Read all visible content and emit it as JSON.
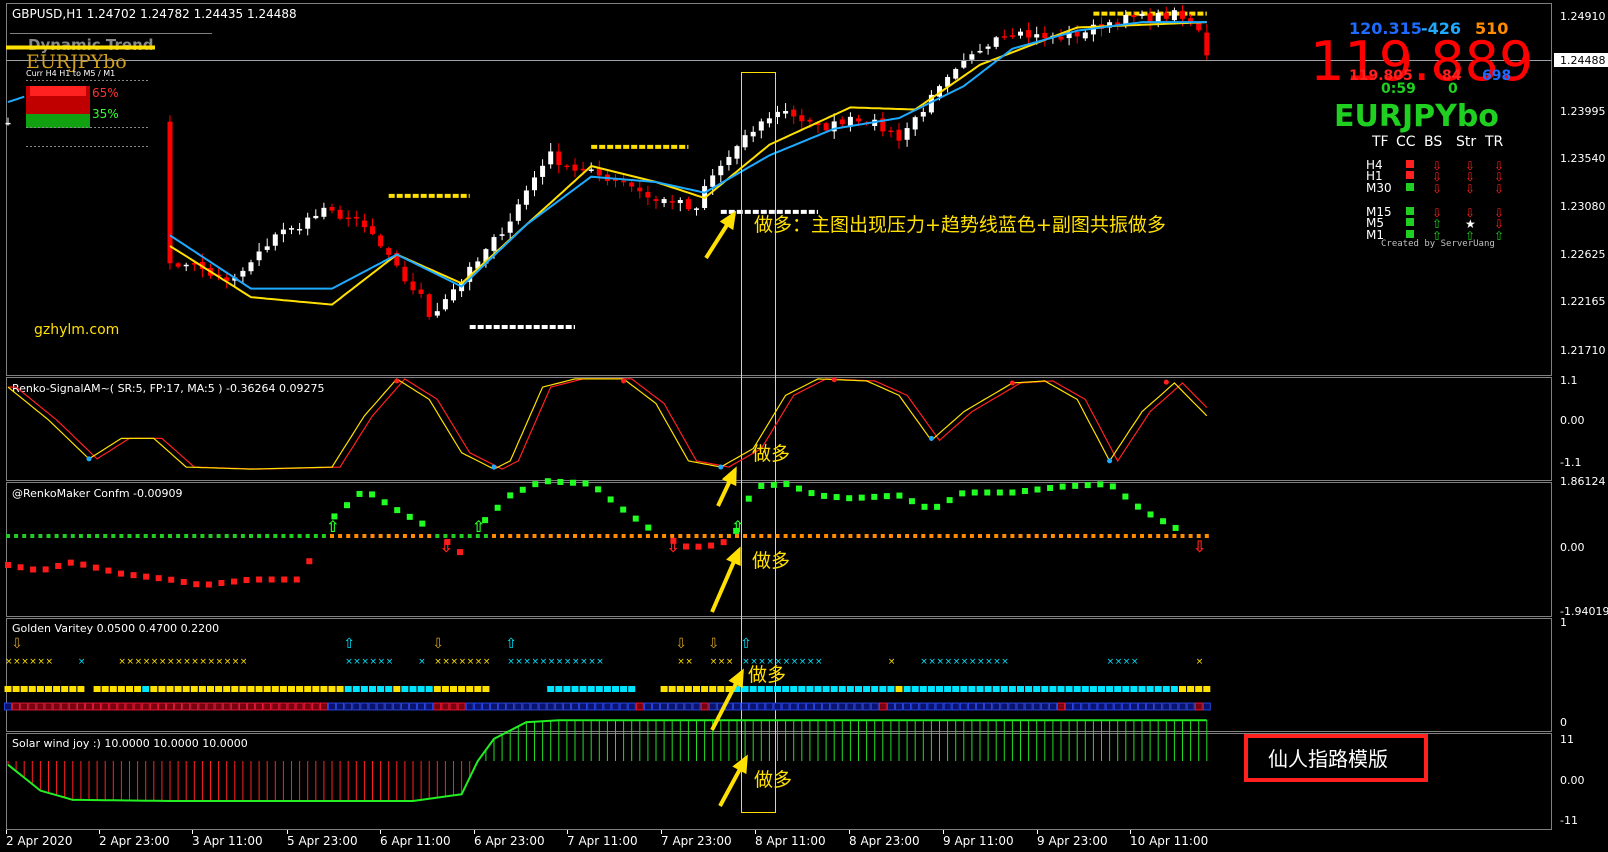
{
  "colors": {
    "bull": "#ffffff",
    "bear": "#ff0000",
    "yellow": "#ffe000",
    "blue": "#1eaaff",
    "green": "#20d020",
    "lime": "#22ff22",
    "cyan": "#00e5ff",
    "orange": "#ff8c00",
    "grid": "#808080",
    "text": "#ffffff"
  },
  "main": {
    "header": "GBPUSD,H1  1.24702 1.24782 1.24435 1.24488",
    "current_price": "1.24488",
    "price_labels": [
      "1.24910",
      "1.24488",
      "1.23995",
      "1.23540",
      "1.23080",
      "1.22625",
      "1.22165",
      "1.21710"
    ],
    "watermark": "gzhylm.com",
    "annotation": "做多：主图出现压力+趋势线蓝色+副图共振做多",
    "dyn_title": "Dynamic Trend",
    "dyn_symbol": "EURJPYbo",
    "dyn_header": "Curr   H4  H1    to    M5 / M1",
    "dyn_pct_red": "65%",
    "dyn_pct_green": "35%"
  },
  "info_panel": {
    "price_small": "120.315",
    "diff": "-426",
    "spread": "510",
    "price_big": "119.889",
    "low": "119.805",
    "n1": "84",
    "n2": "698",
    "timer": "0:59",
    "zero": "0",
    "symbol": "EURJPYbo",
    "columns": [
      "TF",
      "CC",
      "BS",
      "Str",
      "TR"
    ],
    "rows": [
      {
        "tf": "H4",
        "cc": "red",
        "bs": "down",
        "str": "down",
        "tr": "down"
      },
      {
        "tf": "H1",
        "cc": "red",
        "bs": "down",
        "str": "down",
        "tr": "down"
      },
      {
        "tf": "M30",
        "cc": "green",
        "bs": "down",
        "str": "down",
        "tr": "down"
      },
      {
        "tf": "M15",
        "cc": "green",
        "bs": "down",
        "str": "down",
        "tr": "down"
      },
      {
        "tf": "M5",
        "cc": "green",
        "bs": "up",
        "str": "star",
        "tr": "down"
      },
      {
        "tf": "M1",
        "cc": "green",
        "bs": "up",
        "str": "up",
        "tr": "up"
      }
    ],
    "credit": "Created by ServerUang"
  },
  "panel1": {
    "title": "Renko-SignalAM~( SR:5, FP:17, MA:5 ) -0.36264 0.09275",
    "labels": [
      "1.1",
      "0.00",
      "-1.1"
    ],
    "annotation": "做多"
  },
  "panel2": {
    "title": "@RenkoMaker Confm -0.00909",
    "labels": [
      "1.86124",
      "0.00",
      "-1.94019"
    ],
    "annotation": "做多"
  },
  "panel3": {
    "title": "Golden Varitey 0.0500 0.4700 0.2200",
    "labels": [
      "1",
      "0"
    ],
    "annotation": "做多"
  },
  "panel4": {
    "title": "Solar wind joy :) 10.0000 10.0000 10.0000",
    "labels": [
      "11",
      "0.00",
      "-11"
    ],
    "annotation": "做多",
    "template_label": "仙人指路模版"
  },
  "x_axis": [
    "2 Apr 2020",
    "2 Apr 23:00",
    "3 Apr 11:00",
    "5 Apr 23:00",
    "6 Apr 11:00",
    "6 Apr 23:00",
    "7 Apr 11:00",
    "7 Apr 23:00",
    "8 Apr 11:00",
    "8 Apr 23:00",
    "9 Apr 11:00",
    "9 Apr 23:00",
    "10 Apr 11:00"
  ],
  "chart_data": {
    "type": "candlestick",
    "symbol": "GBPUSD",
    "timeframe": "H1",
    "ylim": [
      1.2149,
      1.2497
    ],
    "last": {
      "open": 1.24702,
      "high": 1.24782,
      "low": 1.24435,
      "close": 1.24488
    },
    "close_path": [
      [
        0,
        1.239
      ],
      [
        4,
        1.238
      ],
      [
        6,
        1.2345
      ],
      [
        9,
        1.231
      ],
      [
        12,
        1.2278
      ],
      [
        15,
        1.2255
      ],
      [
        18,
        1.224
      ],
      [
        20,
        1.225
      ],
      [
        22,
        1.2255
      ],
      [
        24,
        1.2248
      ],
      [
        27,
        1.2235
      ],
      [
        29,
        1.2245
      ],
      [
        31,
        1.2262
      ],
      [
        33,
        1.2282
      ],
      [
        35,
        1.2285
      ],
      [
        37,
        1.2295
      ],
      [
        39,
        1.2302
      ],
      [
        41,
        1.2299
      ],
      [
        43,
        1.2292
      ],
      [
        45,
        1.228
      ],
      [
        47,
        1.2258
      ],
      [
        49,
        1.2238
      ],
      [
        51,
        1.2222
      ],
      [
        52,
        1.2205
      ],
      [
        53,
        1.2212
      ],
      [
        54,
        1.2222
      ],
      [
        56,
        1.2238
      ],
      [
        58,
        1.2255
      ],
      [
        60,
        1.2275
      ],
      [
        62,
        1.2295
      ],
      [
        64,
        1.2322
      ],
      [
        66,
        1.2348
      ],
      [
        67,
        1.2355
      ],
      [
        68,
        1.235
      ],
      [
        70,
        1.2342
      ],
      [
        72,
        1.2338
      ],
      [
        74,
        1.2334
      ],
      [
        76,
        1.2332
      ],
      [
        78,
        1.2322
      ],
      [
        80,
        1.2312
      ],
      [
        82,
        1.2314
      ],
      [
        84,
        1.2305
      ],
      [
        85,
        1.2302
      ],
      [
        86,
        1.2325
      ],
      [
        88,
        1.2345
      ],
      [
        90,
        1.2362
      ],
      [
        92,
        1.2378
      ],
      [
        94,
        1.2392
      ],
      [
        96,
        1.2398
      ],
      [
        98,
        1.2388
      ],
      [
        100,
        1.238
      ],
      [
        102,
        1.2384
      ],
      [
        104,
        1.2392
      ],
      [
        106,
        1.2388
      ],
      [
        108,
        1.238
      ],
      [
        110,
        1.2372
      ],
      [
        112,
        1.239
      ],
      [
        114,
        1.2408
      ],
      [
        116,
        1.2425
      ],
      [
        118,
        1.244
      ],
      [
        120,
        1.2455
      ],
      [
        122,
        1.2468
      ],
      [
        124,
        1.2472
      ],
      [
        126,
        1.2468
      ],
      [
        128,
        1.2465
      ],
      [
        130,
        1.2466
      ],
      [
        132,
        1.2469
      ],
      [
        134,
        1.2474
      ],
      [
        136,
        1.248
      ],
      [
        138,
        1.2483
      ],
      [
        140,
        1.2484
      ],
      [
        142,
        1.2485
      ],
      [
        144,
        1.2487
      ],
      [
        146,
        1.2478
      ],
      [
        148,
        1.2471
      ]
    ],
    "trend_line_blue": [
      [
        0,
        1.2405
      ],
      [
        2,
        1.241
      ],
      [
        10,
        1.2365
      ],
      [
        20,
        1.228
      ],
      [
        30,
        1.223
      ],
      [
        40,
        1.223
      ],
      [
        48,
        1.2262
      ],
      [
        56,
        1.2232
      ],
      [
        64,
        1.229
      ],
      [
        72,
        1.2335
      ],
      [
        80,
        1.233
      ],
      [
        86,
        1.232
      ],
      [
        94,
        1.2355
      ],
      [
        102,
        1.238
      ],
      [
        110,
        1.239
      ],
      [
        118,
        1.242
      ],
      [
        124,
        1.2455
      ],
      [
        132,
        1.2472
      ],
      [
        140,
        1.248
      ],
      [
        148,
        1.248
      ]
    ],
    "trend_line_yellow": [
      [
        20,
        1.227
      ],
      [
        30,
        1.2222
      ],
      [
        40,
        1.2215
      ],
      [
        48,
        1.2262
      ],
      [
        56,
        1.2235
      ],
      [
        64,
        1.229
      ],
      [
        72,
        1.2345
      ],
      [
        80,
        1.233
      ],
      [
        86,
        1.2315
      ],
      [
        94,
        1.2365
      ],
      [
        104,
        1.24
      ],
      [
        112,
        1.2398
      ],
      [
        120,
        1.244
      ],
      [
        132,
        1.2475
      ],
      [
        148,
        1.248
      ]
    ]
  }
}
